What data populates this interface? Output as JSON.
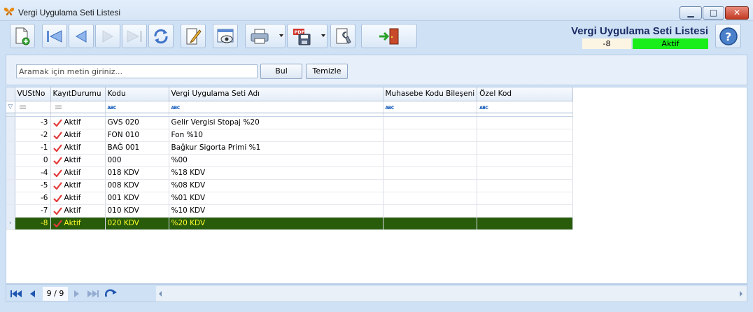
{
  "window": {
    "title": "Vergi Uygulama Seti Listesi",
    "controls": {
      "minimize": "▁",
      "maximize": "□",
      "close": "✕"
    }
  },
  "toolbar": {
    "buttons": [
      {
        "name": "new-record-button",
        "icon": "new-document-icon",
        "enabled": true
      },
      {
        "name": "first-record-button",
        "icon": "first-icon",
        "enabled": true
      },
      {
        "name": "previous-record-button",
        "icon": "previous-icon",
        "enabled": true
      },
      {
        "name": "next-record-button",
        "icon": "next-icon",
        "enabled": false
      },
      {
        "name": "last-record-button",
        "icon": "last-icon",
        "enabled": false
      },
      {
        "name": "refresh-button",
        "icon": "refresh-icon",
        "enabled": true
      },
      {
        "name": "edit-button",
        "icon": "edit-icon",
        "enabled": true
      },
      {
        "name": "preview-button",
        "icon": "preview-icon",
        "enabled": true
      },
      {
        "name": "print-button",
        "icon": "printer-icon",
        "enabled": true
      },
      {
        "name": "export-pdf-button",
        "icon": "pdf-save-icon",
        "enabled": true
      },
      {
        "name": "settings-button",
        "icon": "wrench-icon",
        "enabled": true
      },
      {
        "name": "exit-button",
        "icon": "exit-door-icon",
        "enabled": true
      }
    ]
  },
  "header": {
    "form_title": "Vergi Uygulama Seti Listesi",
    "record_id": "-8",
    "record_status": "Aktif",
    "status_color": "#1aee1a"
  },
  "search": {
    "placeholder": "Aramak için metin giriniz...",
    "value": "",
    "find_label": "Bul",
    "clear_label": "Temizle"
  },
  "grid": {
    "columns": [
      "VUStNo",
      "KayıtDurumu",
      "Kodu",
      "Vergi Uygulama Seti Adı",
      "Muhasebe Kodu Bileşeni",
      "Özel Kod"
    ],
    "rows": [
      {
        "no": "-3",
        "status": "Aktif",
        "code": "GVS 020",
        "name": "Gelir Vergisi Stopaj %20",
        "acc": "",
        "special": "",
        "style": "normal"
      },
      {
        "no": "-2",
        "status": "Aktif",
        "code": "FON 010",
        "name": "Fon %10",
        "acc": "",
        "special": "",
        "style": "alt"
      },
      {
        "no": "-1",
        "status": "Aktif",
        "code": "BAĞ 001",
        "name": "Bağkur Sigorta Primi %1",
        "acc": "",
        "special": "",
        "style": "normal"
      },
      {
        "no": "0",
        "status": "Aktif",
        "code": "000",
        "name": "%00",
        "acc": "",
        "special": "",
        "style": "alt"
      },
      {
        "no": "-4",
        "status": "Aktif",
        "code": "018 KDV",
        "name": "%18 KDV",
        "acc": "",
        "special": "",
        "style": "normal"
      },
      {
        "no": "-5",
        "status": "Aktif",
        "code": "008 KDV",
        "name": "%08 KDV",
        "acc": "",
        "special": "",
        "style": "alt"
      },
      {
        "no": "-6",
        "status": "Aktif",
        "code": "001 KDV",
        "name": "%01 KDV",
        "acc": "",
        "special": "",
        "style": "normal"
      },
      {
        "no": "-7",
        "status": "Aktif",
        "code": "010 KDV",
        "name": "%10 KDV",
        "acc": "",
        "special": "",
        "style": "hl"
      },
      {
        "no": "-8",
        "status": "Aktif",
        "code": "020 KDV",
        "name": "%20 KDV",
        "acc": "",
        "special": "",
        "style": "sel"
      }
    ]
  },
  "navigator": {
    "position": "9 / 9"
  },
  "colors": {
    "highlight_row": "#ffff00",
    "selected_row_bg": "#285b0a",
    "selected_row_text": "#ffff2c",
    "check_mark": "#e23a3a"
  }
}
